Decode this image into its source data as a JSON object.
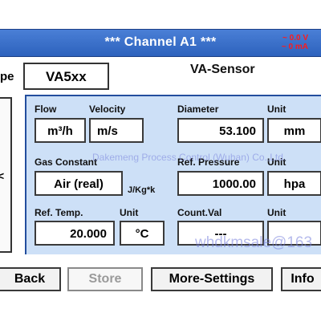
{
  "window": {
    "title": "***  Channel A1  ***",
    "status_voltage": "~ 0.0 V",
    "status_current": "~ 0 mA",
    "status_color": "#ff1a1a",
    "title_bar_color": "#3a6fd0"
  },
  "header": {
    "type_label": "pe",
    "type_value": "VA5xx",
    "sensor_name": "VA-Sensor"
  },
  "left_panel": {
    "glyph": "<"
  },
  "fields": {
    "flow": {
      "label": "Flow",
      "value": "m³/h"
    },
    "velocity": {
      "label": "Velocity",
      "value": "m/s"
    },
    "diameter": {
      "label": "Diameter",
      "value": "53.100"
    },
    "diameter_unit": {
      "label": "Unit",
      "value": "mm"
    },
    "gas_constant": {
      "label": "Gas Constant",
      "value": "Air (real)",
      "unit_text": "J/Kg*k"
    },
    "ref_pressure": {
      "label": "Ref. Pressure",
      "value": "1000.00"
    },
    "pressure_unit": {
      "label": "Unit",
      "value": "hpa"
    },
    "ref_temp": {
      "label": "Ref. Temp.",
      "value": "20.000"
    },
    "temp_unit": {
      "label": "Unit",
      "value": "°C"
    },
    "count_val": {
      "label": "Count.Val",
      "value": "---"
    },
    "count_unit": {
      "label": "Unit",
      "value": ""
    }
  },
  "watermarks": {
    "line1": "Dakemeng Process Control (Wuhan) Co.,Ltd.",
    "line2": "whdkmsale@163"
  },
  "buttons": {
    "back": "Back",
    "store": "Store",
    "more_settings": "More-Settings",
    "info": "Info"
  },
  "colors": {
    "panel_bg": "#cde0f7",
    "panel_border": "#234e9e"
  }
}
